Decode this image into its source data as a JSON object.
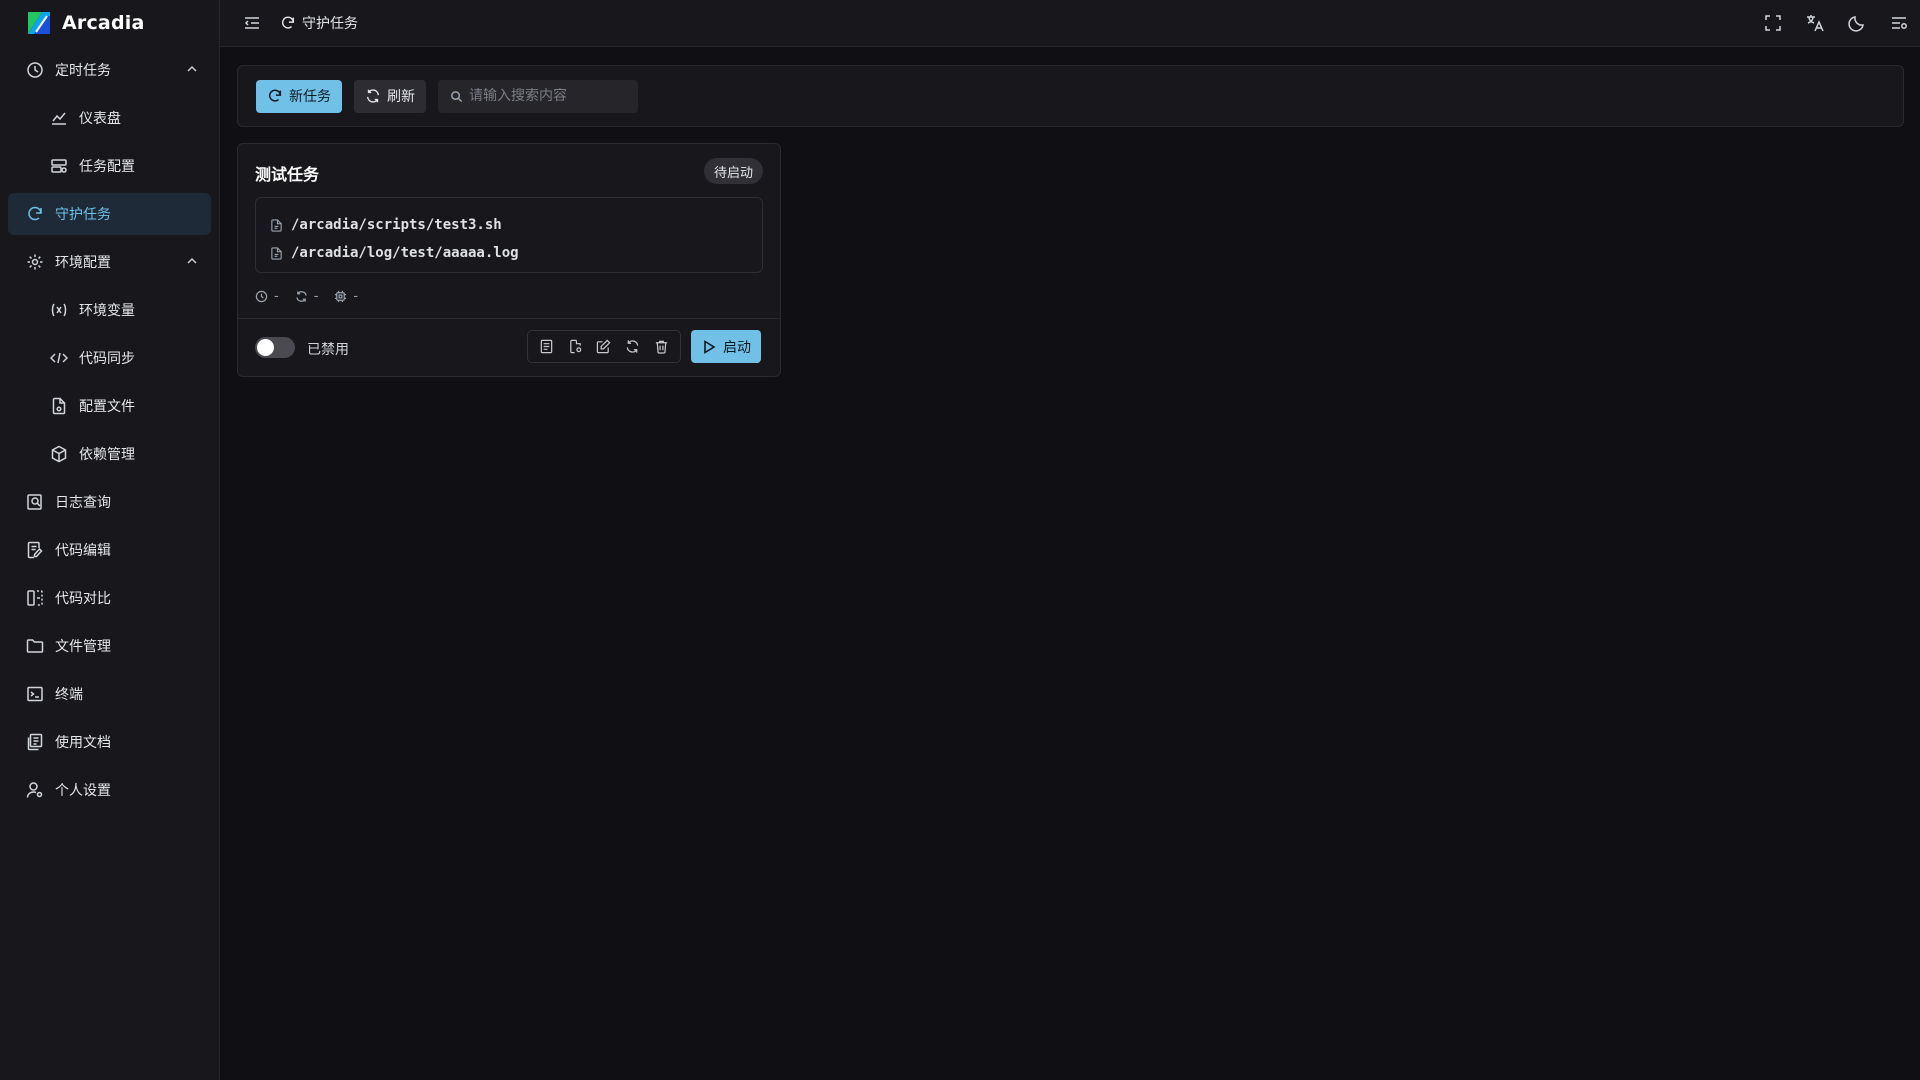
{
  "app": {
    "name": "Arcadia"
  },
  "sidebar": {
    "groups": {
      "scheduled": {
        "label": "定时任务"
      },
      "env": {
        "label": "环境配置"
      }
    },
    "items": {
      "dashboard": "仪表盘",
      "task_config": "任务配置",
      "daemon_tasks": "守护任务",
      "env_vars": "环境变量",
      "code_sync": "代码同步",
      "config_files": "配置文件",
      "dependencies": "依赖管理",
      "log_query": "日志查询",
      "code_edit": "代码编辑",
      "code_diff": "代码对比",
      "file_manager": "文件管理",
      "terminal": "终端",
      "docs": "使用文档",
      "profile": "个人设置"
    },
    "active": "daemon_tasks"
  },
  "header": {
    "breadcrumb": "守护任务"
  },
  "toolbar": {
    "new_task": "新任务",
    "refresh": "刷新",
    "search_placeholder": "请输入搜索内容"
  },
  "tasks": [
    {
      "name": "测试任务",
      "status": "待启动",
      "script_path": "/arcadia/scripts/test3.sh",
      "log_path": "/arcadia/log/test/aaaaa.log",
      "meta": {
        "time": "-",
        "restarts": "-",
        "cpu": "-"
      },
      "enabled": false,
      "enabled_label": "已禁用",
      "start_label": "启动"
    }
  ],
  "colors": {
    "accent": "#70c0e8",
    "bg": "#101014",
    "panel": "#18181c"
  }
}
